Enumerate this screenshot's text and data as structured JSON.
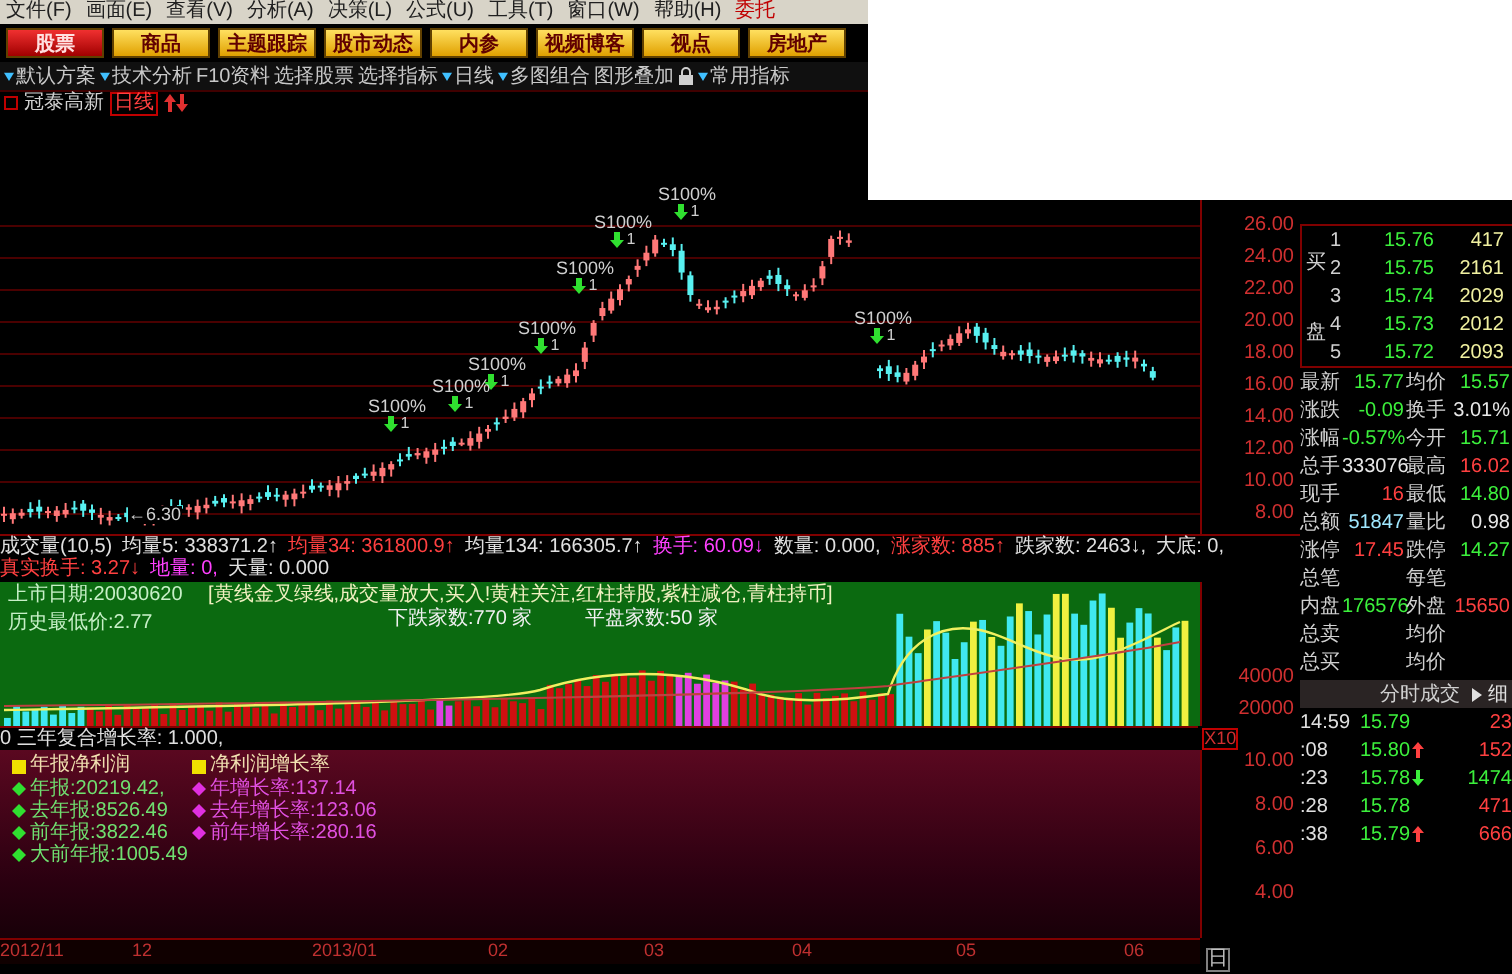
{
  "menu": [
    {
      "label": "文件(F)",
      "kind": "menu"
    },
    {
      "label": "画面(E)",
      "kind": "menu"
    },
    {
      "label": "查看(V)",
      "kind": "menu"
    },
    {
      "label": "分析(A)",
      "kind": "menu"
    },
    {
      "label": "决策(L)",
      "kind": "menu"
    },
    {
      "label": "公式(U)",
      "kind": "menu"
    },
    {
      "label": "工具(T)",
      "kind": "menu"
    },
    {
      "label": "窗口(W)",
      "kind": "menu"
    },
    {
      "label": "帮助(H)",
      "kind": "menu"
    },
    {
      "label": "委托",
      "kind": "trade"
    }
  ],
  "nav_buttons": [
    {
      "label": "股票",
      "selected": true
    },
    {
      "label": "商品",
      "selected": false
    },
    {
      "label": "主题跟踪",
      "selected": false
    },
    {
      "label": "股市动态",
      "selected": false
    },
    {
      "label": "内参",
      "selected": false
    },
    {
      "label": "视频博客",
      "selected": false
    },
    {
      "label": "视点",
      "selected": false
    },
    {
      "label": "房地产",
      "selected": false
    }
  ],
  "toolbar": [
    {
      "kind": "button",
      "label": "默认方案",
      "dropdown": true
    },
    {
      "kind": "button",
      "label": "技术分析",
      "dropdown": true
    },
    {
      "kind": "button",
      "label": "F10资料",
      "dropdown": false
    },
    {
      "kind": "button",
      "label": "选择股票",
      "dropdown": false
    },
    {
      "kind": "button",
      "label": "选择指标",
      "dropdown": false
    },
    {
      "kind": "button",
      "label": "日线",
      "dropdown": true
    },
    {
      "kind": "button",
      "label": "多图组合",
      "dropdown": true
    },
    {
      "kind": "button",
      "label": "图形叠加",
      "dropdown": false
    },
    {
      "kind": "lock"
    },
    {
      "kind": "button",
      "label": "常用指标",
      "dropdown": true
    }
  ],
  "stock": {
    "name": "冠泰高新",
    "period": "日线"
  },
  "price_chart": {
    "signals": [
      {
        "label": "S100%",
        "count": "1"
      },
      {
        "label": "S100%",
        "count": "1"
      },
      {
        "label": "S100%",
        "count": "1"
      },
      {
        "label": "S100%",
        "count": "1"
      },
      {
        "label": "S100%",
        "count": "1"
      },
      {
        "label": "S100%",
        "count": "1"
      },
      {
        "label": "S100%",
        "count": "1"
      },
      {
        "label": "S100%",
        "count": "1"
      }
    ],
    "low_label": "←6.30",
    "price_axis": [
      "26.00",
      "24.00",
      "22.00",
      "20.00",
      "18.00",
      "16.00",
      "14.00",
      "12.00",
      "10.00",
      "8.00"
    ]
  },
  "indicator_line": [
    {
      "text": "成交量(10,5)",
      "color": "#e0e0e0"
    },
    {
      "text": "均量5: 338371.2↑",
      "color": "#e0e0e0"
    },
    {
      "text": "均量34: 361800.9↑",
      "color": "#ff4040"
    },
    {
      "text": "均量134: 166305.7↑",
      "color": "#e0e0e0"
    },
    {
      "text": "换手: 60.09↓",
      "color": "#ff40ff"
    },
    {
      "text": "数量: 0.000,",
      "color": "#e0e0e0"
    },
    {
      "text": "涨家数: 885↑",
      "color": "#ff4040"
    },
    {
      "text": "跌家数: 2463↓,",
      "color": "#e0e0e0"
    },
    {
      "text": "大底: 0,",
      "color": "#e0e0e0"
    },
    {
      "text": "真实换手: 3.27↓",
      "color": "#ff4040"
    },
    {
      "text": "地量: 0,",
      "color": "#ff40ff"
    },
    {
      "text": "天量: 0.000",
      "color": "#e0e0e0"
    }
  ],
  "volume_panel": {
    "listing_date": "上市日期:20030620",
    "lowest_price": "历史最低价:2.77",
    "signal_text": "[黄线金叉绿线,成交量放大,买入!黄柱关注,红柱持股,紫柱减仓,青柱持币]",
    "down_count": "下跌家数:770 家",
    "flat_count": "平盘家数:50 家",
    "axis": [
      "40000",
      "20000"
    ]
  },
  "formula_line": {
    "text": "0 三年复合增长率: 1.000,",
    "scale": "X10"
  },
  "profit_panel": {
    "legend": [
      "年报净利润",
      "净利润增长率"
    ],
    "profits": [
      "年报:20219.42,",
      "去年报:8526.49",
      "前年报:3822.46",
      "大前年报:1005.49"
    ],
    "growth": [
      "年增长率:137.14",
      "去年增长率:123.06",
      "前年增长率:280.16"
    ],
    "axis": [
      "10.00",
      "8.00",
      "6.00",
      "4.00"
    ]
  },
  "date_axis": [
    "2012/11",
    "12",
    "2013/01",
    "02",
    "03",
    "04",
    "05",
    "06"
  ],
  "period_tab": "日",
  "quote": {
    "bid_labels": [
      "买",
      "盘"
    ],
    "bids": [
      {
        "rank": "1",
        "price": "15.76",
        "volume": "417"
      },
      {
        "rank": "2",
        "price": "15.75",
        "volume": "2161"
      },
      {
        "rank": "3",
        "price": "15.74",
        "volume": "2029"
      },
      {
        "rank": "4",
        "price": "15.73",
        "volume": "2012"
      },
      {
        "rank": "5",
        "price": "15.72",
        "volume": "2093"
      }
    ],
    "stats": [
      {
        "label": "最新",
        "value": "15.77",
        "color": "#3cf03c"
      },
      {
        "label": "均价",
        "value": "15.57",
        "color": "#3cf03c"
      },
      {
        "label": "涨跌",
        "value": "-0.09",
        "color": "#3cf03c"
      },
      {
        "label": "换手",
        "value": "3.01%",
        "color": "#e8e8e8"
      },
      {
        "label": "涨幅",
        "value": "-0.57%",
        "color": "#3cf03c"
      },
      {
        "label": "今开",
        "value": "15.71",
        "color": "#3cf03c"
      },
      {
        "label": "总手",
        "value": "333076",
        "color": "#e8e8e8"
      },
      {
        "label": "最高",
        "value": "16.02",
        "color": "#ff4040"
      },
      {
        "label": "现手",
        "value": "16",
        "color": "#ff4040"
      },
      {
        "label": "最低",
        "value": "14.80",
        "color": "#3cf03c"
      },
      {
        "label": "总额",
        "value": "51847",
        "color": "#a0e8ff"
      },
      {
        "label": "量比",
        "value": "0.98",
        "color": "#e8e8e8"
      },
      {
        "label": "涨停",
        "value": "17.45",
        "color": "#ff4040"
      },
      {
        "label": "跌停",
        "value": "14.27",
        "color": "#3cf03c"
      },
      {
        "label": "总笔"
      },
      {
        "label": "每笔"
      },
      {
        "label": "内盘",
        "value": "176576",
        "color": "#3cf03c"
      },
      {
        "label": "外盘",
        "value": "15650",
        "color": "#ff4040"
      },
      {
        "label": "总卖"
      },
      {
        "label": "均价"
      },
      {
        "label": "总买"
      },
      {
        "label": "均价"
      }
    ],
    "trades_title": "分时成交",
    "trades_detail": "细",
    "trades": [
      {
        "time": "14:59",
        "price": "15.79",
        "rising": false,
        "falling": false,
        "volume": "23",
        "color": "#ff4040"
      },
      {
        "time": ":08",
        "price": "15.80",
        "rising": true,
        "falling": false,
        "volume": "152",
        "color": "#ff4040"
      },
      {
        "time": ":23",
        "price": "15.78",
        "rising": false,
        "falling": true,
        "volume": "1474",
        "color": "#3cf03c"
      },
      {
        "time": ":28",
        "price": "15.78",
        "rising": false,
        "falling": false,
        "volume": "471",
        "color": "#ff4040"
      },
      {
        "time": ":38",
        "price": "15.79",
        "rising": true,
        "falling": false,
        "volume": "666",
        "color": "#ff4040"
      }
    ]
  }
}
